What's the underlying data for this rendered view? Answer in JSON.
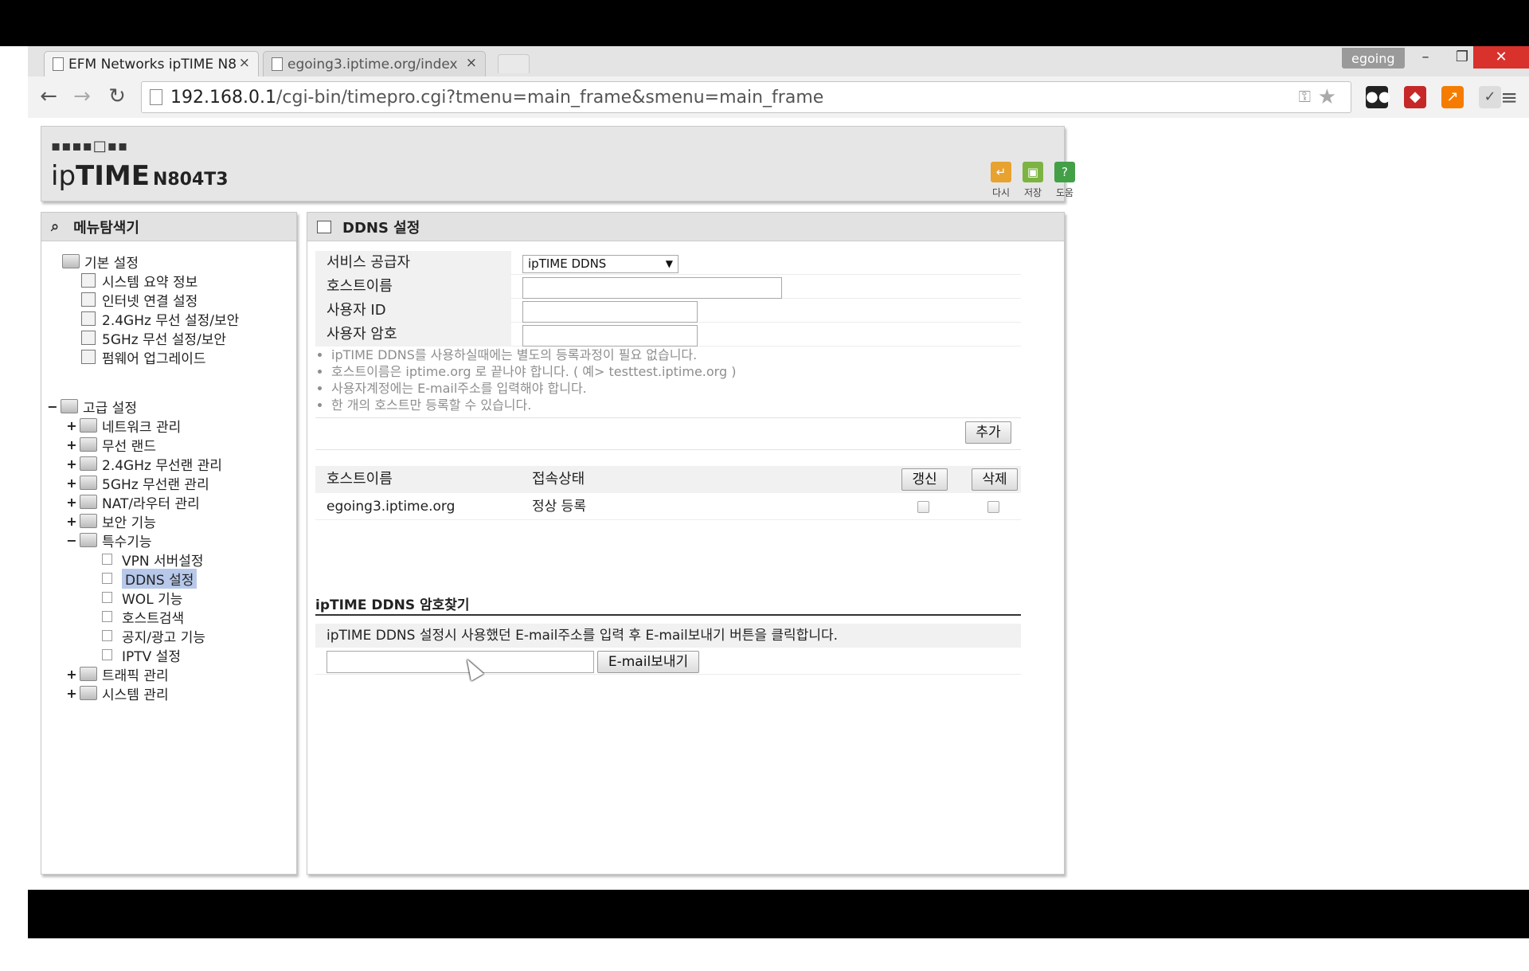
{
  "browser": {
    "tabs": [
      {
        "label": "EFM Networks ipTIME N8"
      },
      {
        "label": "egoing3.iptime.org/index"
      }
    ],
    "tab_close": "×",
    "profile": "egoing",
    "window": {
      "minimize": "–",
      "restore": "❐",
      "close": "✕"
    },
    "url_host": "192.168.0.1",
    "url_path": "/cgi-bin/timepro.cgi?tmenu=main_frame&smenu=main_frame",
    "nav": {
      "back": "←",
      "forward": "→",
      "reload": "↻"
    }
  },
  "router": {
    "brand_dots": "▪▪▪▪□▪▪",
    "brand_ip": "ip",
    "brand_time": "TIME",
    "brand_model": "N804T3",
    "tools": [
      {
        "icon": "↵",
        "label": "다시",
        "color": "#e8a22f"
      },
      {
        "icon": "▣",
        "label": "저장",
        "color": "#7cb342"
      },
      {
        "icon": "?",
        "label": "도움",
        "color": "#43a047"
      }
    ]
  },
  "sidebar": {
    "title": "메뉴탐색기",
    "basic": {
      "label": "기본 설정",
      "items": [
        "시스템 요약 정보",
        "인터넷 연결 설정",
        "2.4GHz 무선 설정/보안",
        "5GHz 무선 설정/보안",
        "펌웨어 업그레이드"
      ]
    },
    "advanced": {
      "label": "고급 설정",
      "items": [
        "네트워크 관리",
        "무선 랜드",
        "2.4GHz 무선랜 관리",
        "5GHz 무선랜 관리",
        "NAT/라우터 관리",
        "보안 기능"
      ],
      "special": {
        "label": "특수기능",
        "items": [
          "VPN 서버설정",
          "DDNS 설정",
          "WOL 기능",
          "호스트검색",
          "공지/광고 기능",
          "IPTV 설정"
        ]
      },
      "tail": [
        "트래픽 관리",
        "시스템 관리"
      ]
    }
  },
  "main": {
    "title": "DDNS 설정",
    "form": {
      "provider_label": "서비스 공급자",
      "provider_value": "ipTIME DDNS",
      "hostname_label": "호스트이름",
      "userid_label": "사용자 ID",
      "password_label": "사용자 암호"
    },
    "notes": [
      "ipTIME DDNS를 사용하실때에는 별도의 등록과정이 필요 없습니다.",
      "호스트이름은 iptime.org 로 끝나야 합니다. ( 예> testtest.iptime.org )",
      "사용자계정에는 E-mail주소를 입력해야 합니다.",
      "한 개의 호스트만 등록할 수 있습니다."
    ],
    "add_button": "추가",
    "table": {
      "col_host": "호스트이름",
      "col_status": "접속상태",
      "refresh_button": "갱신",
      "delete_button": "삭제",
      "rows": [
        {
          "host": "egoing3.iptime.org",
          "status": "정상 등록"
        }
      ]
    },
    "password_find": {
      "title": "ipTIME DDNS 암호찾기",
      "desc": "ipTIME DDNS 설정시 사용했던 E-mail주소를 입력 후 E-mail보내기 버튼을 클릭합니다.",
      "send_button": "E-mail보내기"
    }
  }
}
